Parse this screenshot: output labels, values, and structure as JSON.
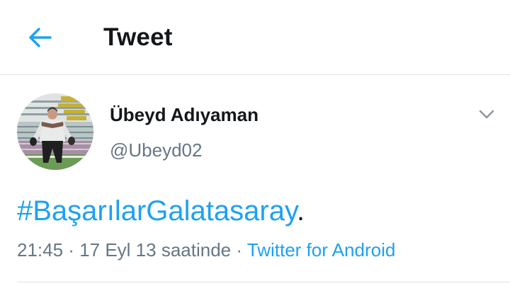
{
  "header": {
    "title": "Tweet",
    "back_icon": "arrow-left-icon"
  },
  "colors": {
    "accent": "#1da1f2",
    "secondary_text": "#657786",
    "primary_text": "#14171a",
    "divider": "#e1e3e6"
  },
  "tweet": {
    "author": {
      "display_name": "Übeyd Adıyaman",
      "handle": "@Ubeyd02",
      "avatar": "user-avatar-photo"
    },
    "menu_icon": "chevron-down-icon",
    "text": {
      "hashtag": "#BaşarılarGalatasaray",
      "suffix": "."
    },
    "meta": {
      "time": "21:45",
      "sep1": " · ",
      "date": "17 Eyl 13 saatinde",
      "sep2": " · ",
      "source": "Twitter for Android"
    }
  }
}
